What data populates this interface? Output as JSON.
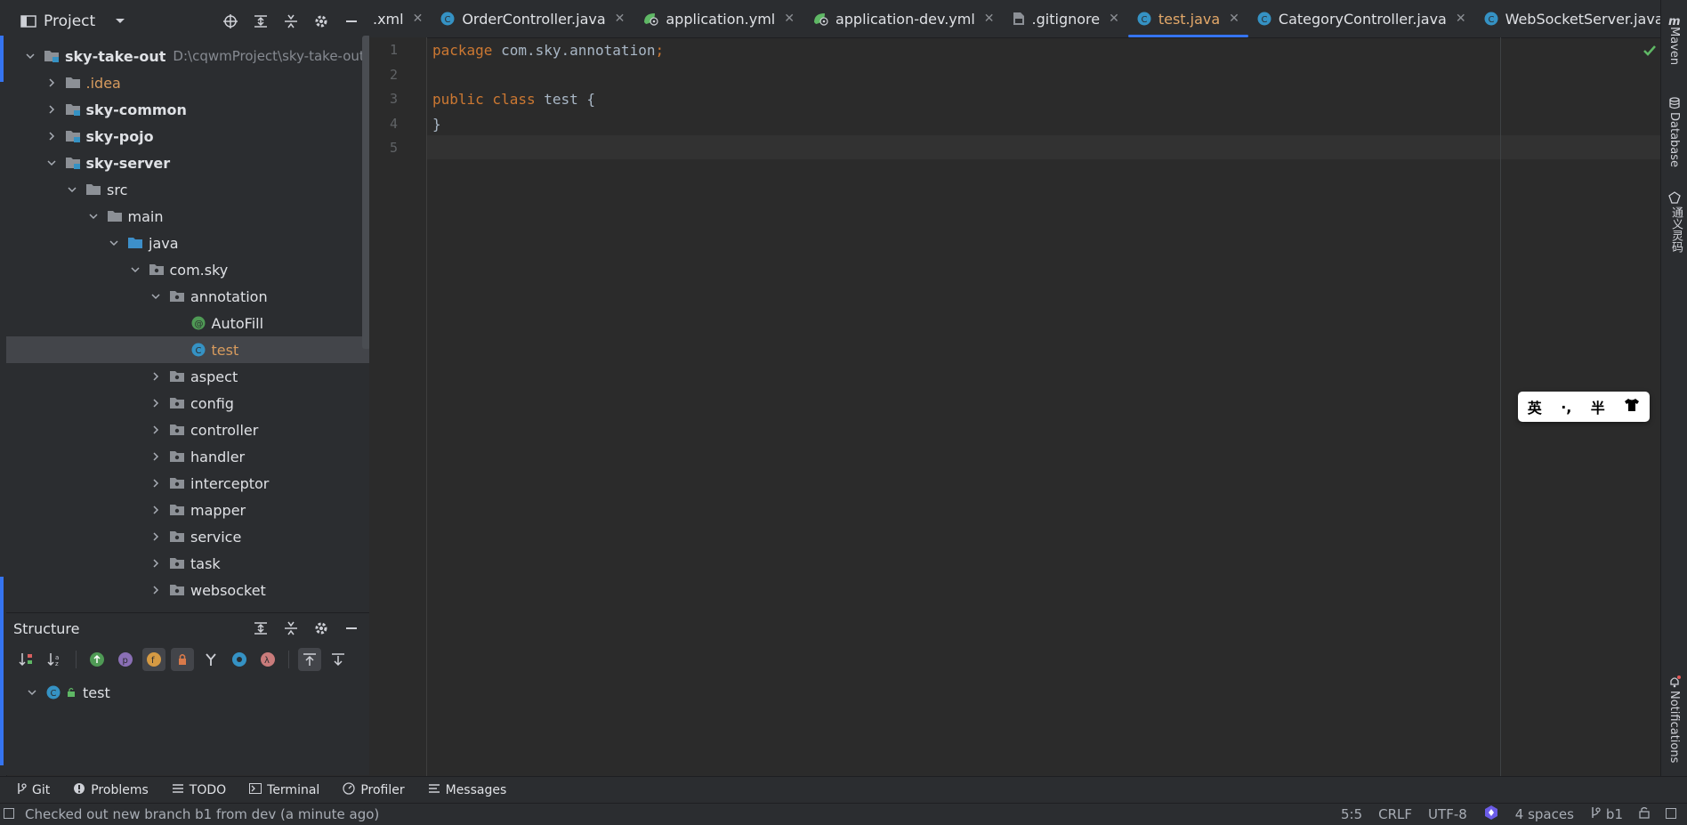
{
  "project_panel": {
    "title": "Project",
    "tree": [
      {
        "label": "sky-take-out",
        "hint": "D:\\cqwmProject\\sky-take-out",
        "level": 0,
        "expanded": true,
        "icon": "module-folder-icon",
        "bold": true
      },
      {
        "label": ".idea",
        "level": 1,
        "expanded": false,
        "icon": "folder-icon",
        "orange": true
      },
      {
        "label": "sky-common",
        "level": 1,
        "expanded": false,
        "icon": "module-folder-icon",
        "bold": true
      },
      {
        "label": "sky-pojo",
        "level": 1,
        "expanded": false,
        "icon": "module-folder-icon",
        "bold": true
      },
      {
        "label": "sky-server",
        "level": 1,
        "expanded": true,
        "icon": "module-folder-icon",
        "bold": true
      },
      {
        "label": "src",
        "level": 2,
        "expanded": true,
        "icon": "folder-icon"
      },
      {
        "label": "main",
        "level": 3,
        "expanded": true,
        "icon": "folder-icon"
      },
      {
        "label": "java",
        "level": 4,
        "expanded": true,
        "icon": "source-folder-icon"
      },
      {
        "label": "com.sky",
        "level": 5,
        "expanded": true,
        "icon": "package-icon"
      },
      {
        "label": "annotation",
        "level": 6,
        "expanded": true,
        "icon": "package-icon"
      },
      {
        "label": "AutoFill",
        "level": 7,
        "icon": "annotation-icon"
      },
      {
        "label": "test",
        "level": 7,
        "icon": "class-icon",
        "selected": true,
        "orange": true
      },
      {
        "label": "aspect",
        "level": 6,
        "expanded": false,
        "icon": "package-icon"
      },
      {
        "label": "config",
        "level": 6,
        "expanded": false,
        "icon": "package-icon"
      },
      {
        "label": "controller",
        "level": 6,
        "expanded": false,
        "icon": "package-icon"
      },
      {
        "label": "handler",
        "level": 6,
        "expanded": false,
        "icon": "package-icon"
      },
      {
        "label": "interceptor",
        "level": 6,
        "expanded": false,
        "icon": "package-icon"
      },
      {
        "label": "mapper",
        "level": 6,
        "expanded": false,
        "icon": "package-icon"
      },
      {
        "label": "service",
        "level": 6,
        "expanded": false,
        "icon": "package-icon"
      },
      {
        "label": "task",
        "level": 6,
        "expanded": false,
        "icon": "package-icon"
      },
      {
        "label": "websocket",
        "level": 6,
        "expanded": false,
        "icon": "package-icon"
      }
    ]
  },
  "structure_panel": {
    "title": "Structure",
    "tree": [
      {
        "label": "test"
      }
    ]
  },
  "editor": {
    "tabs": [
      {
        "label": ".xml",
        "icon": ""
      },
      {
        "label": "OrderController.java",
        "icon": "class-icon"
      },
      {
        "label": "application.yml",
        "icon": "spring-config-icon"
      },
      {
        "label": "application-dev.yml",
        "icon": "spring-config-icon"
      },
      {
        "label": ".gitignore",
        "icon": "ignore-file-icon"
      },
      {
        "label": "test.java",
        "icon": "class-icon",
        "active": true
      },
      {
        "label": "CategoryController.java",
        "icon": "class-icon"
      },
      {
        "label": "WebSocketServer.java",
        "icon": "class-icon"
      }
    ],
    "lines": [
      {
        "num": "1",
        "kw": "package",
        "rest": " com.sky.annotation;"
      },
      {
        "num": "2",
        "kw": "",
        "rest": ""
      },
      {
        "num": "3",
        "kw": "public class",
        "rest": " test {"
      },
      {
        "num": "4",
        "kw": "",
        "rest": "}"
      },
      {
        "num": "5",
        "kw": "",
        "rest": ""
      }
    ]
  },
  "ime_popup": {
    "items": [
      "英",
      "·,",
      "半",
      "shirt-icon"
    ]
  },
  "right_tools": [
    "Maven",
    "Database",
    "通义灵码",
    "Notifications"
  ],
  "bottom_tools": [
    "Git",
    "Problems",
    "TODO",
    "Terminal",
    "Profiler",
    "Messages"
  ],
  "status_bar": {
    "message": "Checked out new branch b1 from dev (a minute ago)",
    "position": "5:5",
    "line_ending": "CRLF",
    "encoding": "UTF-8",
    "indent": "4 spaces",
    "branch": "b1"
  }
}
